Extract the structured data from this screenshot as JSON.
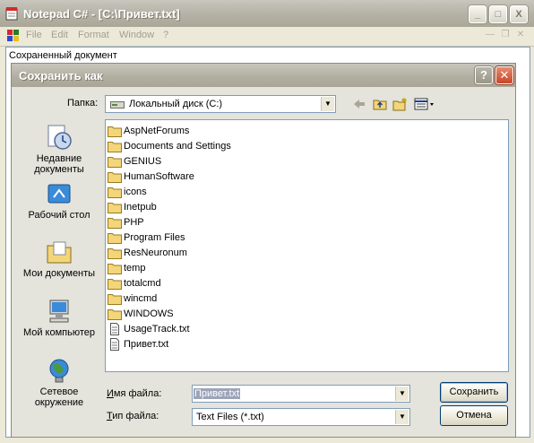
{
  "window": {
    "title": "Notepad C# - [C:\\Привет.txt]",
    "controls": [
      "_",
      "□",
      "X"
    ]
  },
  "menubar": {
    "items": [
      "File",
      "Edit",
      "Format",
      "Window",
      "?"
    ],
    "mdi_controls": [
      "—",
      "❐",
      "✕"
    ]
  },
  "document": {
    "status_text": "Сохраненный документ"
  },
  "dialog": {
    "title": "Сохранить как",
    "help_label": "?",
    "close_label": "✕",
    "folder_label": "Папка:",
    "folder_value": "Локальный диск (C:)",
    "places": [
      {
        "label": "Недавние документы",
        "icon": "recent-documents-icon"
      },
      {
        "label": "Рабочий стол",
        "icon": "desktop-icon"
      },
      {
        "label": "Мои документы",
        "icon": "my-documents-icon"
      },
      {
        "label": "Мой компьютер",
        "icon": "my-computer-icon"
      },
      {
        "label": "Сетевое окружение",
        "icon": "network-places-icon"
      }
    ],
    "files": [
      {
        "name": "AspNetForums",
        "type": "folder"
      },
      {
        "name": "Documents and Settings",
        "type": "folder"
      },
      {
        "name": "GENIUS",
        "type": "folder"
      },
      {
        "name": "HumanSoftware",
        "type": "folder"
      },
      {
        "name": "icons",
        "type": "folder"
      },
      {
        "name": "Inetpub",
        "type": "folder"
      },
      {
        "name": "PHP",
        "type": "folder"
      },
      {
        "name": "Program Files",
        "type": "folder"
      },
      {
        "name": "ResNeuronum",
        "type": "folder"
      },
      {
        "name": "temp",
        "type": "folder"
      },
      {
        "name": "totalcmd",
        "type": "folder"
      },
      {
        "name": "wincmd",
        "type": "folder"
      },
      {
        "name": "WINDOWS",
        "type": "folder"
      },
      {
        "name": "UsageTrack.txt",
        "type": "file"
      },
      {
        "name": "Привет.txt",
        "type": "file"
      }
    ],
    "filename_label": "Имя файла:",
    "filename_value": "Привет.txt",
    "filetype_label": "Тип файла:",
    "filetype_value": "Text Files (*.txt)",
    "save_button": "Сохранить",
    "cancel_button": "Отмена"
  },
  "colors": {
    "folder": "#f3d57a",
    "accent": "#003c74",
    "close_red": "#c8452a"
  }
}
